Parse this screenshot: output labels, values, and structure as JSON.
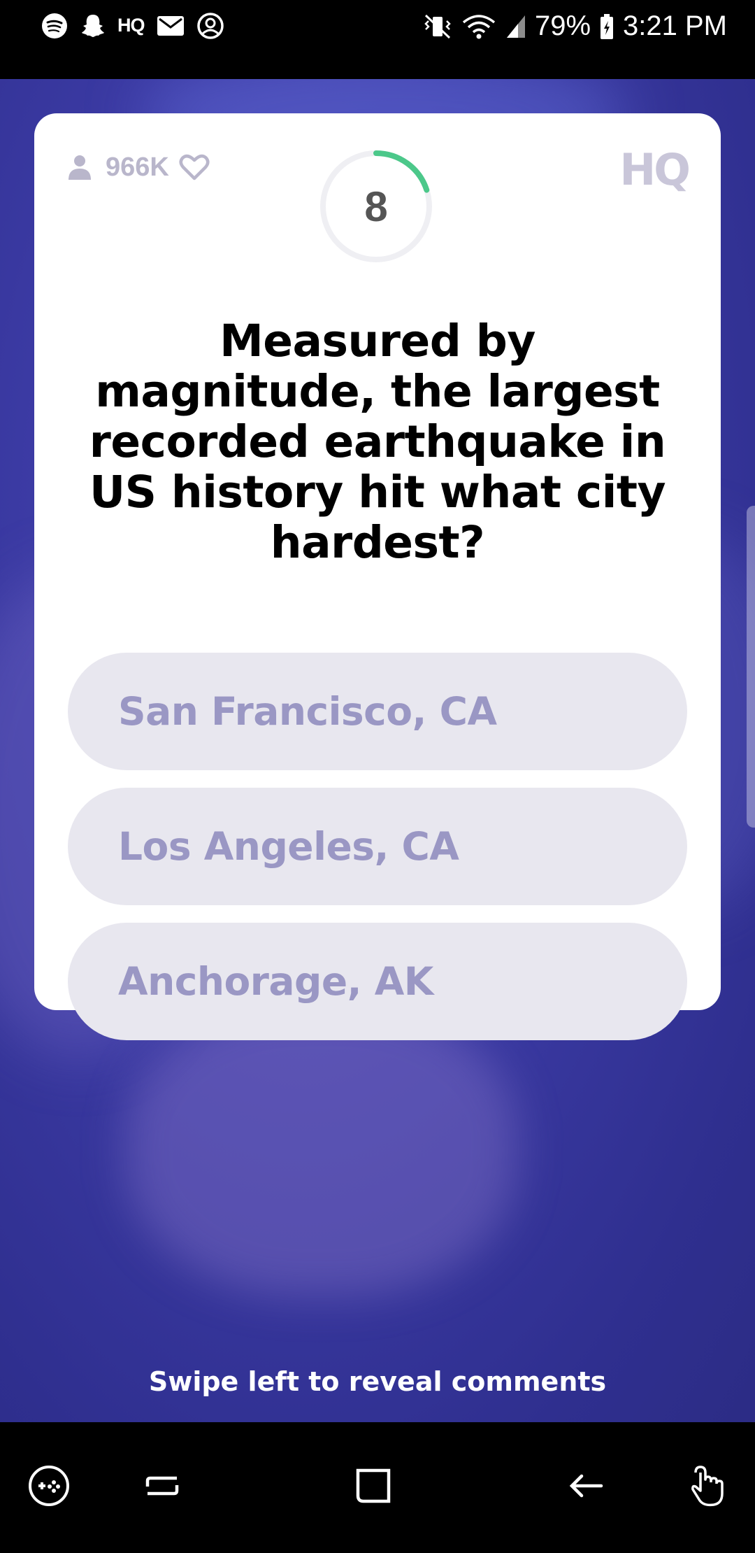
{
  "status_bar": {
    "left_icons": [
      "spotify-icon",
      "snapchat-icon",
      "hq-icon",
      "gmail-icon",
      "account-icon"
    ],
    "hq_label": "HQ",
    "right_icons": [
      "vibrate-mute-icon",
      "wifi-icon",
      "signal-icon",
      "battery-icon"
    ],
    "battery": "79%",
    "time": "3:21 PM"
  },
  "game": {
    "viewer_count": "966K",
    "timer": "8",
    "timer_progress": 0.2,
    "logo": "HQ",
    "question": "Measured by magnitude, the largest recorded earthquake in US history hit what city hardest?",
    "answers": [
      {
        "label": "San Francisco, CA"
      },
      {
        "label": "Los Angeles, CA"
      },
      {
        "label": "Anchorage, AK"
      }
    ],
    "swipe_hint": "Swipe left to reveal comments"
  },
  "colors": {
    "background": "#3b3aa3",
    "answer_fill": "#e8e7ef",
    "answer_text": "#9a97c4",
    "timer_accent": "#4cc88a"
  },
  "nav_bar": {
    "buttons": [
      "game-launcher-icon",
      "recent-apps-icon",
      "home-icon",
      "back-icon",
      "touch-gesture-icon"
    ]
  }
}
